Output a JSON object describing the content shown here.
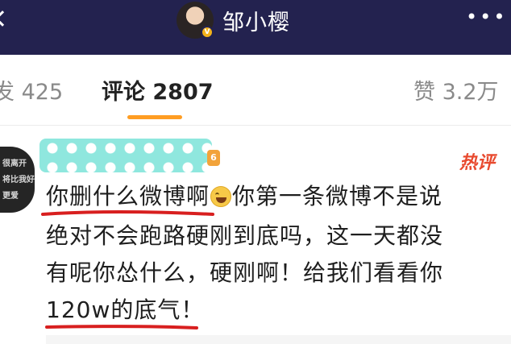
{
  "header": {
    "username": "邹小樱",
    "verified_badge": "V",
    "more_label": "•••",
    "colors": {
      "background": "#23224f"
    }
  },
  "tabs": {
    "repost": "发 425",
    "comments": "评论 2807",
    "likes": "赞 3.2万",
    "active": "comments",
    "accent": "#ff9d22"
  },
  "comment": {
    "avatar_text": [
      "很离开",
      "将比我好",
      "更爱"
    ],
    "level": "6",
    "hot_label": "热评",
    "lines": [
      [
        "你删什么微博啊",
        "你第一条微博不是说"
      ],
      "绝对不会跑路硬刚到底吗，这一天都没",
      "有呢你怂什么，硬刚啊！给我们看看你",
      "120w的底气！"
    ],
    "emoji_icon": "laughing-tears-emoji"
  }
}
